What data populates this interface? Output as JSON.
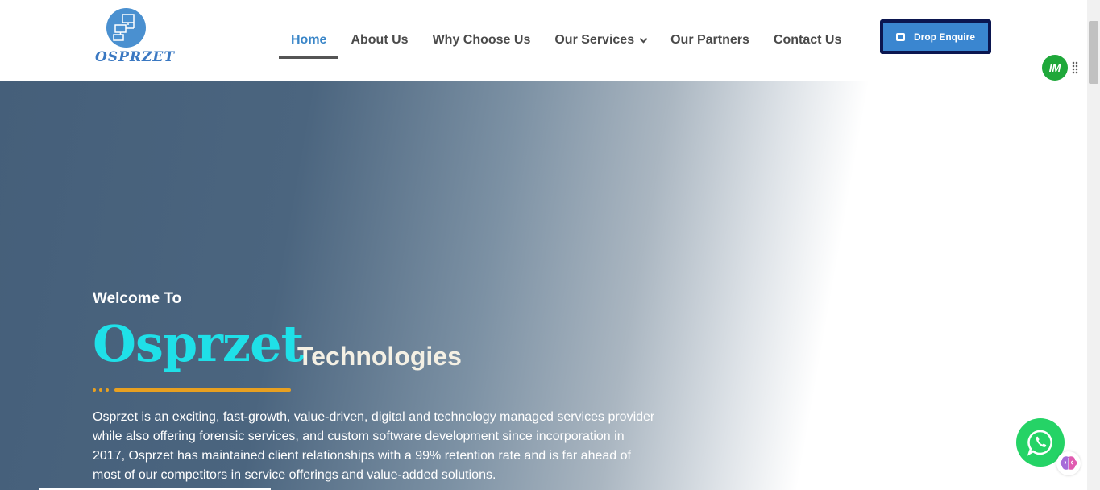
{
  "header": {
    "logo_text": "OSPRZET",
    "logo_icon": "network-computers-icon",
    "nav": [
      {
        "label": "Home",
        "active": true
      },
      {
        "label": "About Us"
      },
      {
        "label": "Why Choose Us"
      },
      {
        "label": "Our Services",
        "dropdown": true
      },
      {
        "label": "Our Partners"
      },
      {
        "label": "Contact Us"
      }
    ],
    "enquire_label": "Drop Enquire",
    "enquire_icon": "message-icon"
  },
  "hero": {
    "welcome": "Welcome To",
    "brand": "Osprzet",
    "tagline": "Technologies",
    "description": "Osprzet is an exciting, fast-growth, value-driven, digital and technology managed services provider while also offering forensic services, and custom software development since incorporation in 2017, Osprzet has maintained client relationships with a 99% retention rate and is far ahead of most of our competitors in service offerings and value-added solutions."
  },
  "widgets": {
    "im_label": "IM",
    "whatsapp_icon": "whatsapp-icon",
    "brain_icon": "brain-icon"
  },
  "colors": {
    "accent": "#3a86c8",
    "brand_cyan": "#1fe0e8",
    "divider": "#e8a020",
    "button_border": "#0b1650"
  }
}
